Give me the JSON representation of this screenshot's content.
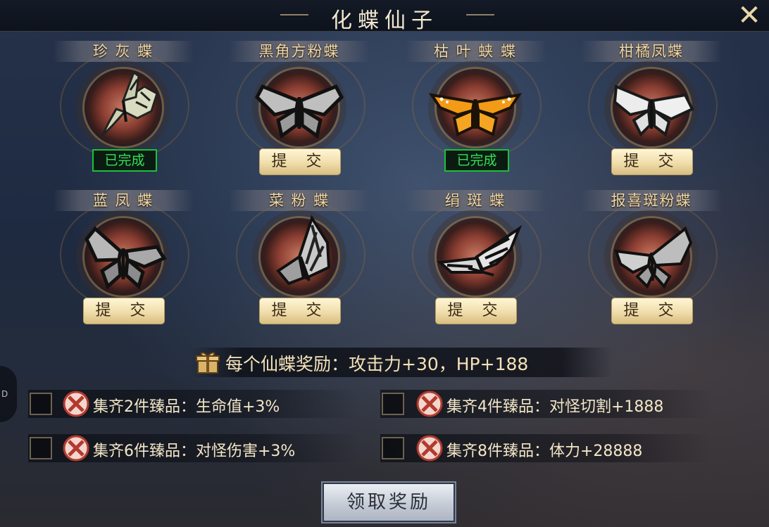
{
  "title": "化蝶仙子",
  "close_label": "✕",
  "side_tab_label": "D",
  "cards": [
    {
      "name": "珍 灰 蝶",
      "status": "已完成",
      "done": true,
      "art": "swallowtail-pale"
    },
    {
      "name": "黑角方粉蝶",
      "status": "提 交",
      "done": false,
      "art": "black-winged"
    },
    {
      "name": "枯 叶 蛱 蝶",
      "status": "已完成",
      "done": true,
      "art": "orange-monarch"
    },
    {
      "name": "柑橘凤蝶",
      "status": "提 交",
      "done": false,
      "art": "white-pieris"
    },
    {
      "name": "蓝 凤 蝶",
      "status": "提 交",
      "done": false,
      "art": "gray-dark"
    },
    {
      "name": "菜 粉 蝶",
      "status": "提 交",
      "done": false,
      "art": "gray-side"
    },
    {
      "name": "绢 斑 蝶",
      "status": "提 交",
      "done": false,
      "art": "zebra-swallowtail"
    },
    {
      "name": "报喜斑粉蝶",
      "status": "提 交",
      "done": false,
      "art": "gray-light"
    }
  ],
  "reward_line": "每个仙蝶奖励：攻击力+30，HP+188",
  "set_bonuses": [
    {
      "text": "集齐2件臻品：生命值+3%"
    },
    {
      "text": "集齐4件臻品：对怪切割+1888"
    },
    {
      "text": "集齐6件臻品：对怪伤害+3%"
    },
    {
      "text": "集齐8件臻品：体力+28888"
    }
  ],
  "claim_label": "领取奖励",
  "colors": {
    "done_green": "#34e255",
    "gold_text": "#f4d9a6",
    "orange_wing": "#f39a16"
  }
}
